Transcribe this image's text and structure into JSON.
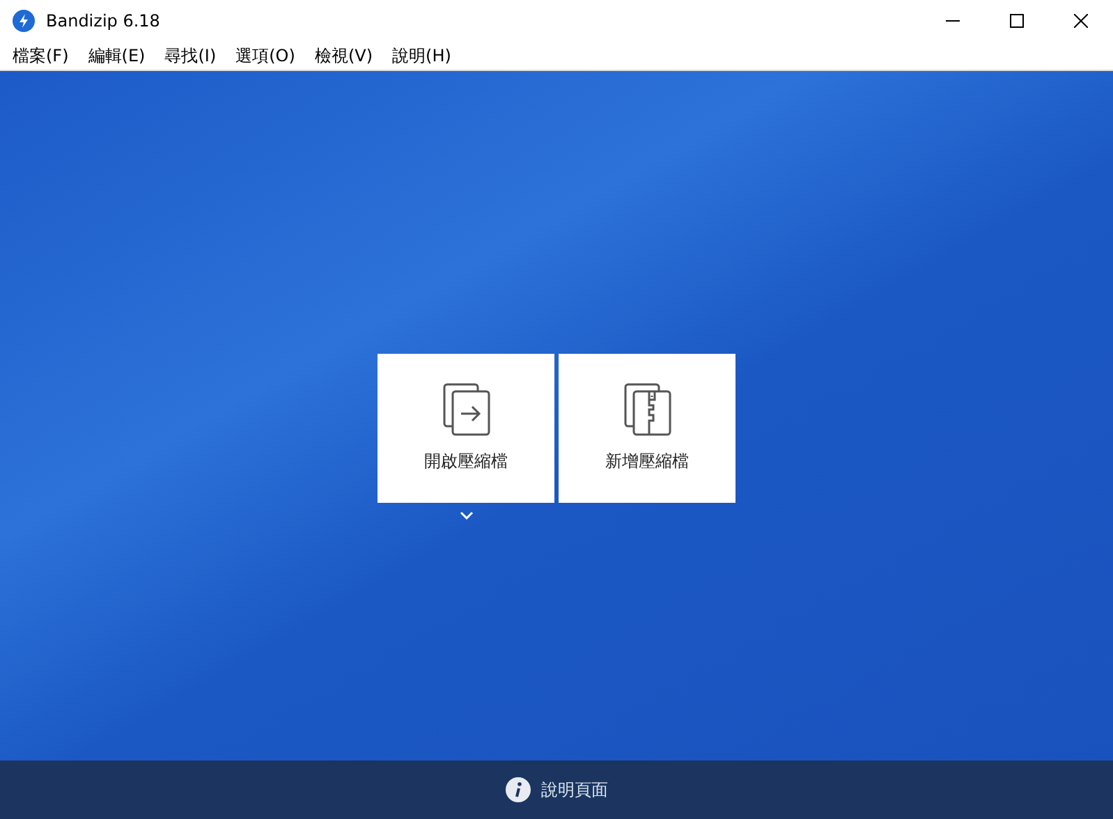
{
  "window": {
    "title": "Bandizip 6.18"
  },
  "menu": [
    "檔案(F)",
    "編輯(E)",
    "尋找(I)",
    "選項(O)",
    "檢視(V)",
    "說明(H)"
  ],
  "actions": [
    {
      "kind": "open",
      "label": "開啟壓縮檔"
    },
    {
      "kind": "new",
      "label": "新增壓縮檔"
    }
  ],
  "status_bar": {
    "label": "說明頁面"
  }
}
